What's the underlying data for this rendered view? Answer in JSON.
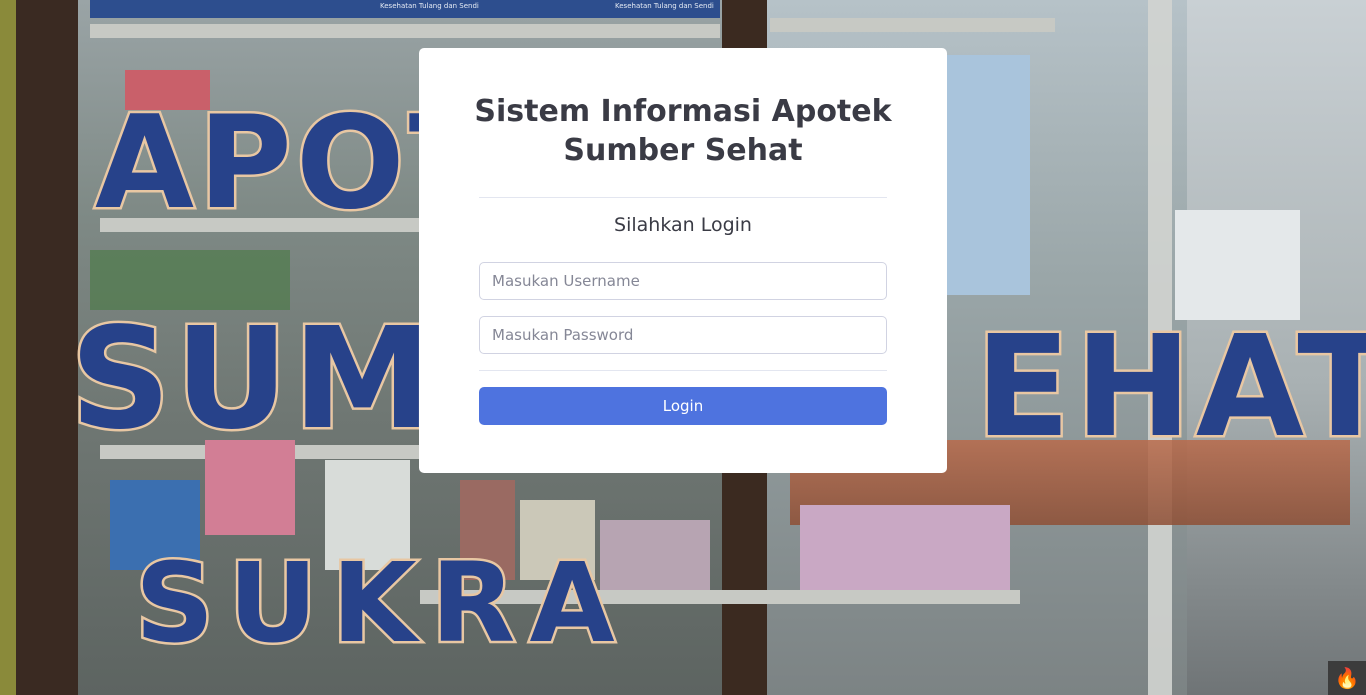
{
  "login": {
    "title_line1": "Sistem Informasi Apotek",
    "title_line2": "Sumber Sehat",
    "subtitle": "Silahkan Login",
    "username_placeholder": "Masukan Username",
    "username_value": "",
    "password_placeholder": "Masukan Password",
    "password_value": "",
    "button_label": "Login"
  },
  "background": {
    "sign_line1": "APOT",
    "sign_line2": "SUMB",
    "sign_line2b": "EHAT",
    "sign_line3": "SUKRA",
    "shelf_label_1": "Kesehatan Tulang dan Sendi",
    "shelf_label_2": "Kesehatan Tulang dan Sendi",
    "corner_icon": "flame-icon"
  },
  "colors": {
    "primary_button": "#4e73df",
    "sign_blue": "#27428a",
    "card_bg": "#ffffff"
  }
}
